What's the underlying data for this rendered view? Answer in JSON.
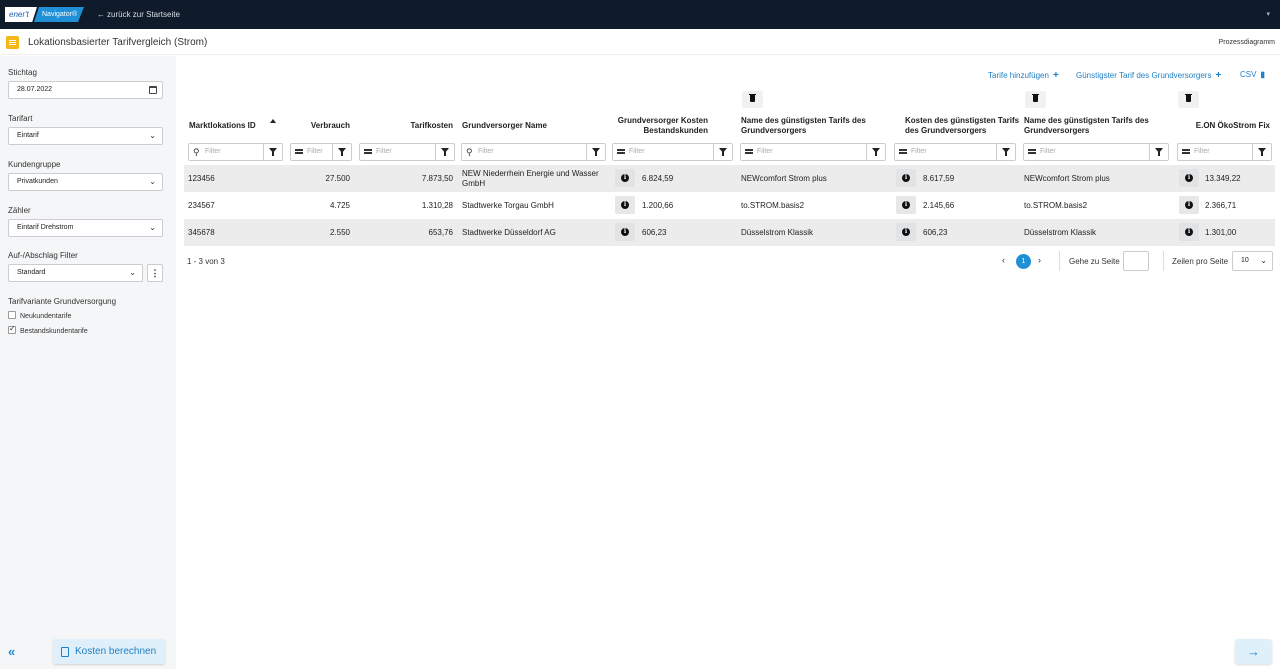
{
  "topbar": {
    "logo_brand": "ener't",
    "logo_product": "Navigator®",
    "back_label": "zurück zur Startseite"
  },
  "header": {
    "title": "Lokationsbasierter Tarifvergleich (Strom)",
    "process_link": "Prozessdiagramm"
  },
  "sidebar": {
    "stichtag_label": "Stichtag",
    "stichtag_value": "28.07.2022",
    "tarifart_label": "Tarifart",
    "tarifart_value": "Eintarif",
    "kundengruppe_label": "Kundengruppe",
    "kundengruppe_value": "Privatkunden",
    "zaehler_label": "Zähler",
    "zaehler_value": "Eintarif Drehstrom",
    "aufabschlag_label": "Auf-/Abschlag Filter",
    "aufabschlag_value": "Standard",
    "variante_label": "Tarifvariante Grundversorgung",
    "options": [
      {
        "label": "Neukundentarife",
        "checked": false
      },
      {
        "label": "Bestandskundentarife",
        "checked": true
      }
    ],
    "calc_button": "Kosten berechnen"
  },
  "toolbar": {
    "add_tariffs": "Tarife hinzufügen",
    "cheapest_tariff": "Günstigster Tarif des Grundversorgers",
    "csv": "CSV"
  },
  "table": {
    "columns": [
      "Marktlokations ID",
      "Verbrauch",
      "Tarifkosten",
      "Grundversorger Name",
      "Grundversorger Kosten Bestandskunden",
      "Name des günstigsten Tarifs des Grundversorgers",
      "Kosten des günstigsten Tarifs des Grundversorgers",
      "Name des günstigsten Tarifs des Grundversorgers",
      "E.ON ÖkoStrom Fix"
    ],
    "filter_placeholder": "Filter",
    "rows": [
      {
        "id": "123456",
        "verbrauch": "27.500",
        "tarifkosten": "7.873,50",
        "gv_name": "NEW Niederrhein Energie und Wasser GmbH",
        "gv_kosten": "6.824,59",
        "name1": "NEWcomfort Strom plus",
        "kosten2": "8.617,59",
        "name2": "NEWcomfort Strom plus",
        "eon": "13.349,22"
      },
      {
        "id": "234567",
        "verbrauch": "4.725",
        "tarifkosten": "1.310,28",
        "gv_name": "Stadtwerke Torgau GmbH",
        "gv_kosten": "1.200,66",
        "name1": "to.STROM.basis2",
        "kosten2": "2.145,66",
        "name2": "to.STROM.basis2",
        "eon": "2.366,71"
      },
      {
        "id": "345678",
        "verbrauch": "2.550",
        "tarifkosten": "653,76",
        "gv_name": "Stadtwerke Düsseldorf AG",
        "gv_kosten": "606,23",
        "name1": "Düsselstrom Klassik",
        "kosten2": "606,23",
        "name2": "Düsselstrom Klassik",
        "eon": "1.301,00"
      }
    ]
  },
  "pager": {
    "info": "1 - 3 von 3",
    "current_page": "1",
    "goto_label": "Gehe zu Seite",
    "rows_label": "Zeilen pro Seite",
    "rows_value": "10"
  },
  "colors": {
    "topbar": "#0f1b2a",
    "accent": "#1f8fd6",
    "sidebar": "#f5f6f7",
    "row_alt": "#ececec"
  }
}
